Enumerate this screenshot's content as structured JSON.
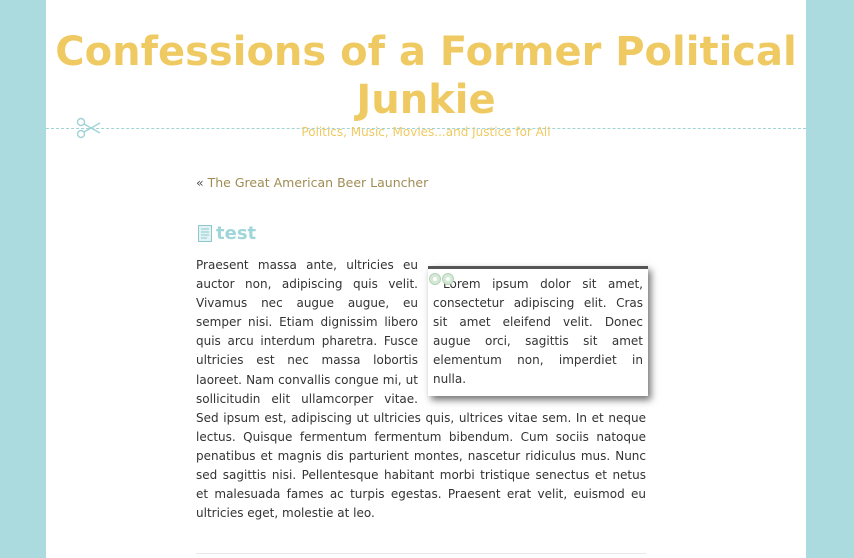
{
  "site": {
    "title": "Confessions of a Former Political Junkie",
    "tagline": "Politics, Music, Movies...and Justice for All"
  },
  "nav": {
    "prev_prefix": "« ",
    "prev_link": "The Great American Beer Launcher"
  },
  "post": {
    "title": "test",
    "quote": "Lorem ipsum dolor sit amet, consectetur adipiscing elit. Cras sit amet eleifend velit. Donec augue orci, sagittis sit amet elementum non, imperdiet in nulla.",
    "body": "Praesent massa ante, ultricies eu auctor non, adipiscing quis velit. Vivamus nec augue augue, eu semper nisi. Etiam dignissim libero quis arcu interdum pharetra. Fusce ultricies est nec massa lobortis laoreet. Nam convallis congue mi, ut sollicitudin elit ullamcorper vitae. Sed ipsum est, adipiscing ut ultricies quis, ultrices vitae sem. In et neque lectus. Quisque fermentum fermentum bibendum. Cum sociis natoque penatibus et magnis dis parturient montes, nascetur ridiculus mus. Nunc sed sagittis nisi. Pellentesque habitant morbi tristique senectus et netus et malesuada fames ac turpis egestas. Praesent erat velit, euismod eu ultricies eget, molestie at leo."
  },
  "icons": {
    "scissors": "scissors-icon",
    "post": "document-icon",
    "quote": "quote-icon"
  },
  "colors": {
    "background": "#acdbdf",
    "title": "#efca62",
    "post_title": "#9fd6da",
    "link": "#a08c53"
  }
}
